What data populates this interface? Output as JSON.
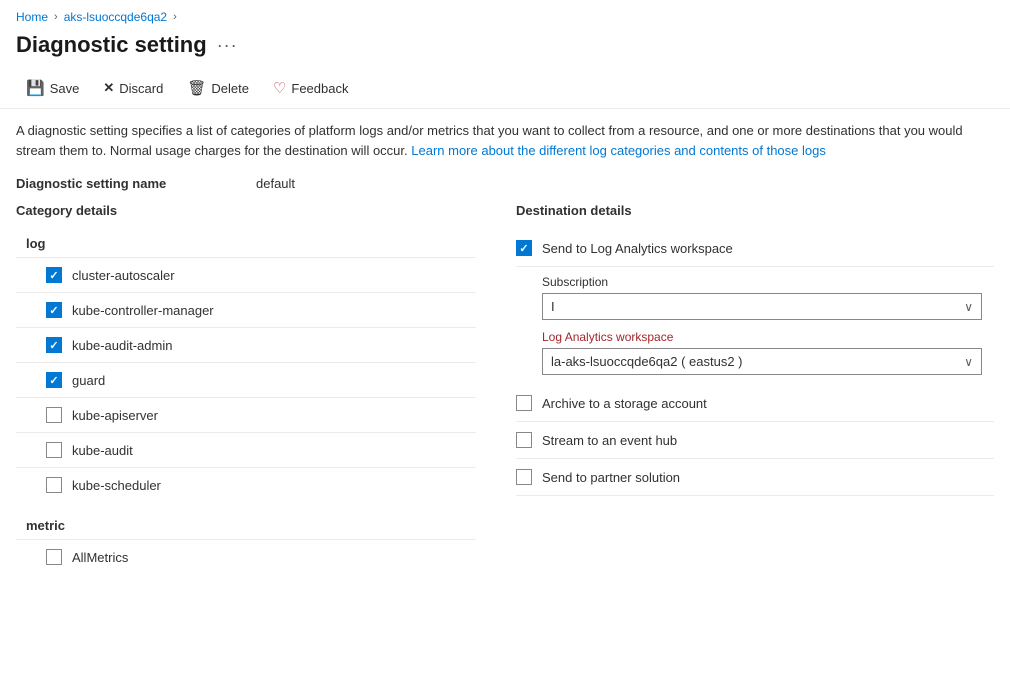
{
  "breadcrumb": {
    "items": [
      {
        "label": "Home",
        "link": true
      },
      {
        "label": "aks-lsuoccqde6qa2",
        "link": true
      }
    ],
    "separator": "›"
  },
  "page": {
    "title": "Diagnostic setting",
    "more_icon": "···"
  },
  "toolbar": {
    "save_label": "Save",
    "discard_label": "Discard",
    "delete_label": "Delete",
    "feedback_label": "Feedback",
    "save_icon": "💾",
    "discard_icon": "✕",
    "delete_icon": "🗑",
    "feedback_icon": "♡"
  },
  "description": {
    "text1": "A diagnostic setting specifies a list of categories of platform logs and/or metrics that you want to collect from a resource, and one or more destinations that you would stream them to. Normal usage charges for the destination will occur.",
    "link_text": "Learn more about the different log categories and contents of those logs",
    "link_href": "#"
  },
  "setting_name": {
    "label": "Diagnostic setting name",
    "value": "default"
  },
  "left_panel": {
    "section_title": "Category details",
    "log_group": {
      "label": "log",
      "items": [
        {
          "label": "cluster-autoscaler",
          "checked": true
        },
        {
          "label": "kube-controller-manager",
          "checked": true
        },
        {
          "label": "kube-audit-admin",
          "checked": true
        },
        {
          "label": "guard",
          "checked": true
        },
        {
          "label": "kube-apiserver",
          "checked": false
        },
        {
          "label": "kube-audit",
          "checked": false
        },
        {
          "label": "kube-scheduler",
          "checked": false
        }
      ]
    },
    "metric_group": {
      "label": "metric",
      "items": [
        {
          "label": "AllMetrics",
          "checked": false
        }
      ]
    }
  },
  "right_panel": {
    "section_title": "Destination details",
    "destinations": [
      {
        "label": "Send to Log Analytics workspace",
        "checked": true,
        "has_fields": true,
        "subscription_label": "Subscription",
        "subscription_value": "I",
        "workspace_label": "Log Analytics workspace",
        "workspace_value": "la-aks-lsuoccqde6qa2 ( eastus2 )"
      },
      {
        "label": "Archive to a storage account",
        "checked": false,
        "has_fields": false
      },
      {
        "label": "Stream to an event hub",
        "checked": false,
        "has_fields": false
      },
      {
        "label": "Send to partner solution",
        "checked": false,
        "has_fields": false
      }
    ]
  }
}
